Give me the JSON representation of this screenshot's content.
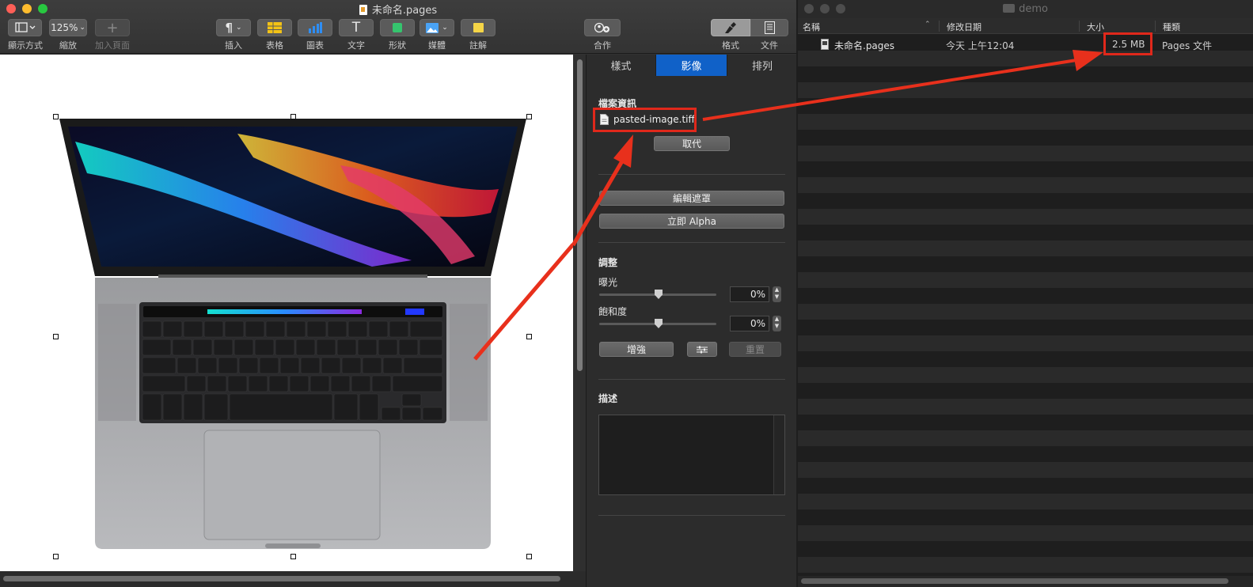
{
  "pages_window": {
    "title": "未命名.pages",
    "toolbar": {
      "view_label": "顯示方式",
      "zoom_value": "125%",
      "zoom_label": "縮放",
      "add_page_label": "加入頁面",
      "insert_label": "插入",
      "table_label": "表格",
      "chart_label": "圖表",
      "text_label": "文字",
      "shape_label": "形狀",
      "media_label": "媒體",
      "comment_label": "註解",
      "collaborate_label": "合作",
      "format_label": "格式",
      "document_label": "文件"
    },
    "inspector": {
      "tabs": [
        "樣式",
        "影像",
        "排列"
      ],
      "file_info_title": "檔案資訊",
      "file_name": "pasted-image.tiff",
      "replace_label": "取代",
      "edit_mask_label": "編輯遮罩",
      "instant_alpha_label": "立即 Alpha",
      "adjust_title": "調整",
      "exposure_label": "曝光",
      "exposure_value": "0%",
      "saturation_label": "飽和度",
      "saturation_value": "0%",
      "enhance_label": "增強",
      "reset_label": "重置",
      "description_title": "描述"
    }
  },
  "finder_window": {
    "title": "demo",
    "columns": {
      "name": "名稱",
      "modified": "修改日期",
      "size": "大小",
      "kind": "種類"
    },
    "files": [
      {
        "name": "未命名.pages",
        "modified": "今天 上午12:04",
        "size": "2.5 MB",
        "kind": "Pages 文件"
      }
    ]
  },
  "colors": {
    "accent_tab": "#1061c8",
    "annotation_red": "#e0281b"
  }
}
